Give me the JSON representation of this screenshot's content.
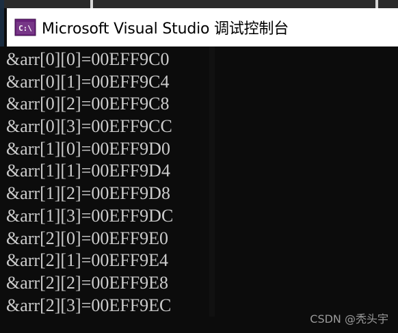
{
  "window": {
    "title": "Microsoft Visual Studio 调试控制台",
    "icon": "console-app-icon",
    "icon_label": "C:\\"
  },
  "console": {
    "lines": [
      "&arr[0][0]=00EFF9C0",
      "&arr[0][1]=00EFF9C4",
      "&arr[0][2]=00EFF9C8",
      "&arr[0][3]=00EFF9CC",
      "&arr[1][0]=00EFF9D0",
      "&arr[1][1]=00EFF9D4",
      "&arr[1][2]=00EFF9D8",
      "&arr[1][3]=00EFF9DC",
      "&arr[2][0]=00EFF9E0",
      "&arr[2][1]=00EFF9E4",
      "&arr[2][2]=00EFF9E8",
      "&arr[2][3]=00EFF9EC"
    ]
  },
  "watermark": "CSDN @秃头宇",
  "colors": {
    "console_background": "#0c0c0c",
    "console_text": "#cccccc",
    "titlebar_background": "#ffffff",
    "icon_purple": "#68217a"
  }
}
